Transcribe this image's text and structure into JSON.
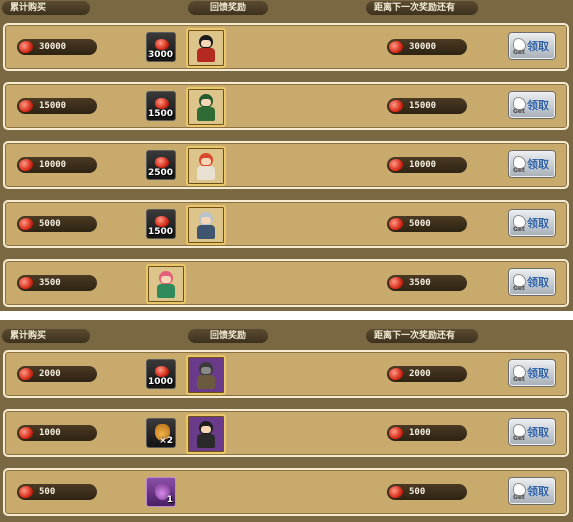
{
  "panels": [
    {
      "headers": {
        "cumulative": "累计购买",
        "reward": "回馈奖励",
        "remaining": "距离下一次奖励还有"
      },
      "rows": [
        {
          "purchase": "30000",
          "gem_qty": "3000",
          "portrait": "red-uniform-soldier",
          "remaining": "30000",
          "claim": "领取",
          "claim_sub": "Get"
        },
        {
          "purchase": "15000",
          "gem_qty": "1500",
          "portrait": "green-capped-soldier",
          "remaining": "15000",
          "claim": "领取",
          "claim_sub": "Get"
        },
        {
          "purchase": "10000",
          "gem_qty": "2500",
          "portrait": "red-haired-girl",
          "remaining": "10000",
          "claim": "领取",
          "claim_sub": "Get"
        },
        {
          "purchase": "5000",
          "gem_qty": "1500",
          "portrait": "silver-haired-girl",
          "remaining": "5000",
          "claim": "领取",
          "claim_sub": "Get"
        },
        {
          "purchase": "3500",
          "gem_qty": "",
          "portrait": "pink-haired-girl",
          "remaining": "3500",
          "claim": "领取",
          "claim_sub": "Get"
        }
      ]
    },
    {
      "headers": {
        "cumulative": "累计购买",
        "reward": "回馈奖励",
        "remaining": "距离下一次奖励还有"
      },
      "rows": [
        {
          "purchase": "2000",
          "gem_qty": "1000",
          "portrait": "hooded-masked-figure",
          "remaining": "2000",
          "claim": "领取",
          "claim_sub": "Get"
        },
        {
          "purchase": "1000",
          "bag_qty": "×2",
          "portrait": "fedora-gangster",
          "remaining": "1000",
          "claim": "领取",
          "claim_sub": "Get"
        },
        {
          "purchase": "500",
          "bag_qty": "1",
          "remaining": "500",
          "claim": "领取",
          "claim_sub": "Get"
        }
      ]
    }
  ],
  "colors": {
    "panel_bg": "#7a6843",
    "row_bg": "#c9aa6d",
    "gem": "#d42a17",
    "claim_text": "#2d5fa3"
  }
}
